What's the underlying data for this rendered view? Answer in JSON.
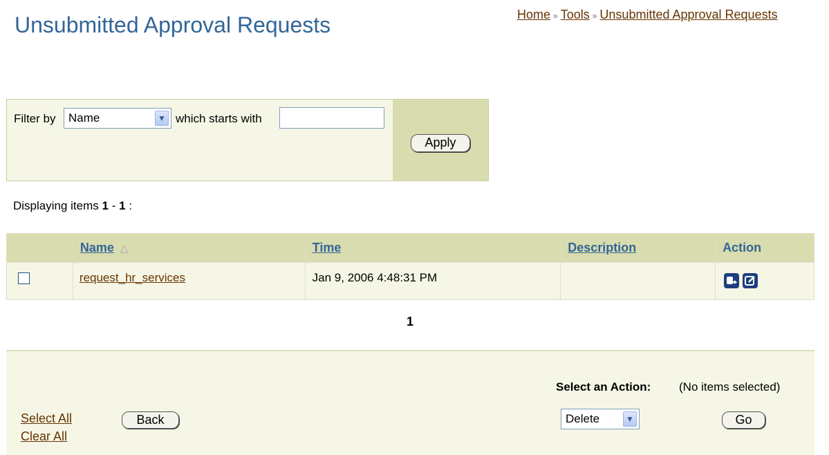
{
  "page": {
    "title": "Unsubmitted Approval Requests",
    "breadcrumb": [
      {
        "label": "Home"
      },
      {
        "label": "Tools"
      },
      {
        "label": "Unsubmitted Approval Requests"
      }
    ],
    "breadcrumb_separator": "»"
  },
  "filter": {
    "filter_by_label": "Filter by",
    "field_selected": "Name",
    "condition_label": "which starts with",
    "value": "",
    "apply_label": "Apply"
  },
  "results": {
    "displaying_prefix": "Displaying items",
    "range_start": "1",
    "range_dash": "-",
    "range_end": "1",
    "range_suffix": ":"
  },
  "table": {
    "columns": [
      {
        "label": "Name",
        "sort_indicator": "△"
      },
      {
        "label": "Time"
      },
      {
        "label": "Description"
      },
      {
        "label": "Action"
      }
    ],
    "rows": [
      {
        "checked": false,
        "name": "request_hr_services",
        "time": "Jan 9, 2006 4:48:31 PM",
        "description": ""
      }
    ],
    "action_icons": [
      "submit-icon",
      "edit-icon"
    ]
  },
  "pagination": {
    "current_page": "1"
  },
  "footer": {
    "select_all": "Select All",
    "clear_all": "Clear All",
    "back_label": "Back",
    "select_action_label": "Select an Action:",
    "selection_status": "(No items selected)",
    "action_selected": "Delete",
    "go_label": "Go"
  },
  "colors": {
    "title": "#336699",
    "link": "#663300",
    "header_bg": "#d9dcae",
    "panel_bg": "#f6f6e6",
    "icon_bg": "#1d3e7e"
  }
}
